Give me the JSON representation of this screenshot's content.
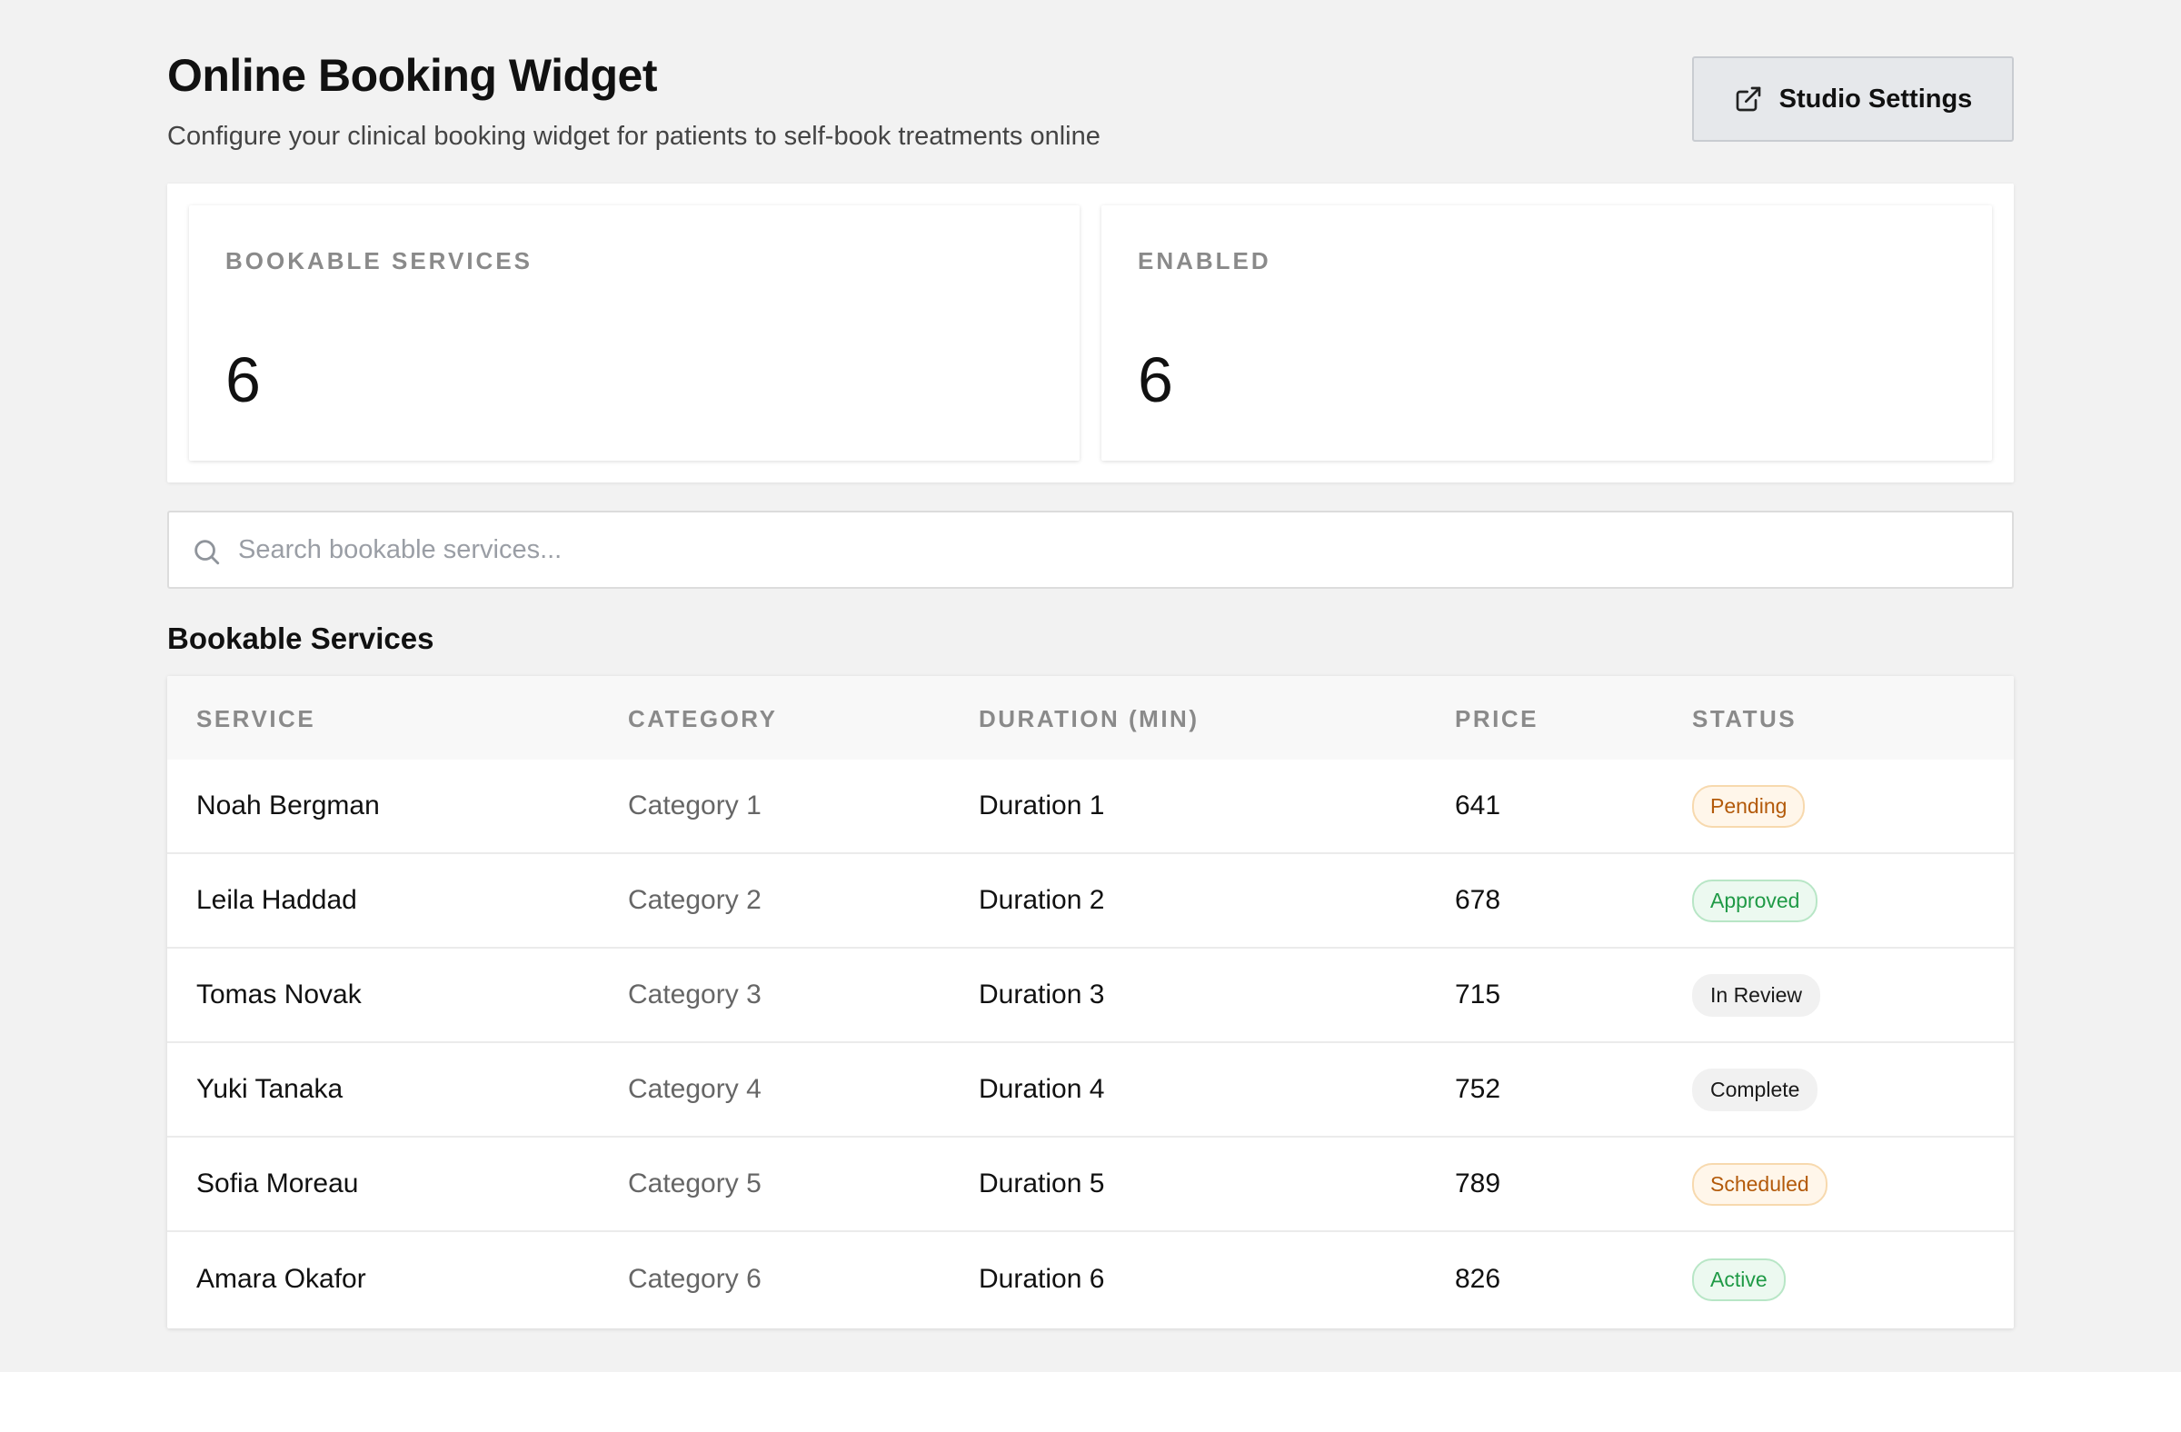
{
  "header": {
    "title": "Online Booking Widget",
    "subtitle": "Configure your clinical booking widget for patients to self-book treatments online",
    "settings_button": {
      "label": "Studio Settings",
      "icon": "external-link-icon"
    }
  },
  "stats": [
    {
      "label": "BOOKABLE SERVICES",
      "value": "6"
    },
    {
      "label": "ENABLED",
      "value": "6"
    }
  ],
  "search": {
    "placeholder": "Search bookable services...",
    "value": "",
    "icon": "search-icon"
  },
  "table": {
    "title": "Bookable Services",
    "columns": [
      "SERVICE",
      "CATEGORY",
      "DURATION (MIN)",
      "PRICE",
      "STATUS"
    ],
    "rows": [
      {
        "service": "Noah Bergman",
        "category": "Category 1",
        "duration": "Duration 1",
        "price": "641",
        "status": "Pending"
      },
      {
        "service": "Leila Haddad",
        "category": "Category 2",
        "duration": "Duration 2",
        "price": "678",
        "status": "Approved"
      },
      {
        "service": "Tomas Novak",
        "category": "Category 3",
        "duration": "Duration 3",
        "price": "715",
        "status": "In Review"
      },
      {
        "service": "Yuki Tanaka",
        "category": "Category 4",
        "duration": "Duration 4",
        "price": "752",
        "status": "Complete"
      },
      {
        "service": "Sofia Moreau",
        "category": "Category 5",
        "duration": "Duration 5",
        "price": "789",
        "status": "Scheduled"
      },
      {
        "service": "Amara Okafor",
        "category": "Category 6",
        "duration": "Duration 6",
        "price": "826",
        "status": "Active"
      }
    ]
  },
  "status_colors": {
    "Pending": "#b35a0a",
    "Approved": "#1f9a46",
    "In Review": "#1a1a1a",
    "Complete": "#1a1a1a",
    "Scheduled": "#b35a0a",
    "Active": "#1f9a46"
  }
}
